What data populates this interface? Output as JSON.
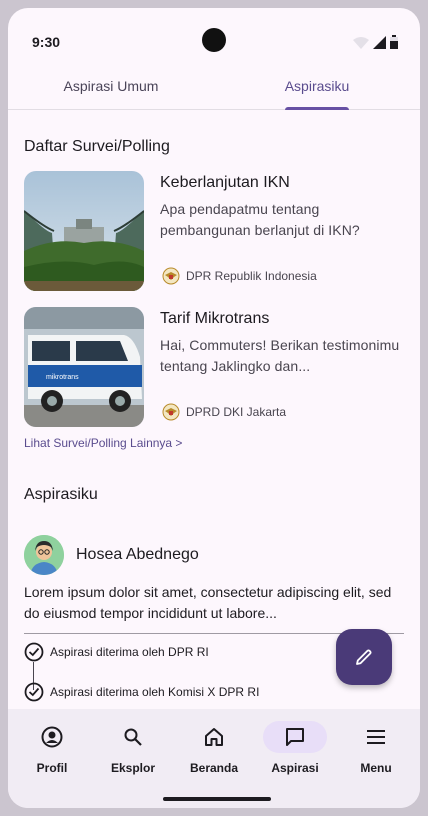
{
  "status_bar": {
    "time": "9:30"
  },
  "tabs": [
    {
      "label": "Aspirasi Umum",
      "active": false
    },
    {
      "label": "Aspirasiku",
      "active": true
    }
  ],
  "survey_section": {
    "title": "Daftar Survei/Polling",
    "items": [
      {
        "title": "Keberlanjutan IKN",
        "description": "Apa pendapatmu tentang pembangunan berlanjut di IKN?",
        "organization": "DPR Republik Indonesia"
      },
      {
        "title": "Tarif Mikrotrans",
        "description": "Hai, Commuters! Berikan testimonimu tentang Jaklingko dan...",
        "organization": "DPRD DKI Jakarta"
      }
    ],
    "more_link": "Lihat Survei/Polling Lainnya >"
  },
  "aspirasiku_section": {
    "title": "Aspirasiku",
    "post": {
      "user_name": "Hosea Abednego",
      "body": "Lorem ipsum dolor sit amet, consectetur adipiscing elit, sed do eiusmod tempor incididunt ut labore...",
      "timeline": [
        "Aspirasi diterima oleh DPR RI",
        "Aspirasi diterima oleh Komisi X DPR RI"
      ]
    }
  },
  "fab": {
    "icon": "pencil-icon"
  },
  "bottom_nav": [
    {
      "label": "Profil",
      "icon": "account-circle-icon",
      "active": false
    },
    {
      "label": "Eksplor",
      "icon": "search-icon",
      "active": false
    },
    {
      "label": "Beranda",
      "icon": "home-icon",
      "active": false
    },
    {
      "label": "Aspirasi",
      "icon": "chat-bubble-icon",
      "active": true
    },
    {
      "label": "Menu",
      "icon": "menu-icon",
      "active": false
    }
  ],
  "colors": {
    "primary": "#6750a4",
    "fab": "#4a3a78",
    "active_pill": "#e8def8",
    "background": "#fdf7fd"
  }
}
